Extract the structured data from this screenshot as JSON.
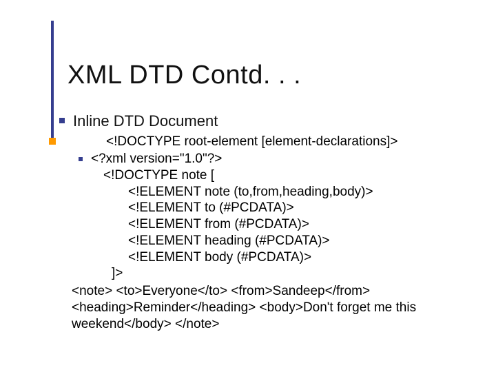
{
  "title": "XML DTD Contd. . .",
  "bullets": {
    "lvl1": "Inline DTD Document",
    "syntax": "<!DOCTYPE root-element [element-declarations]>",
    "code": {
      "l1": "<?xml version=\"1.0\"?>",
      "l2": "<!DOCTYPE note [",
      "l3": "<!ELEMENT note (to,from,heading,body)>",
      "l4": "<!ELEMENT to (#PCDATA)>",
      "l5": "<!ELEMENT from (#PCDATA)>",
      "l6": "<!ELEMENT heading (#PCDATA)>",
      "l7": "<!ELEMENT body (#PCDATA)>",
      "l8": "]>"
    },
    "example": "<note> <to>Everyone</to> <from>Sandeep</from> <heading>Reminder</heading> <body>Don't forget me this weekend</body> </note>"
  }
}
